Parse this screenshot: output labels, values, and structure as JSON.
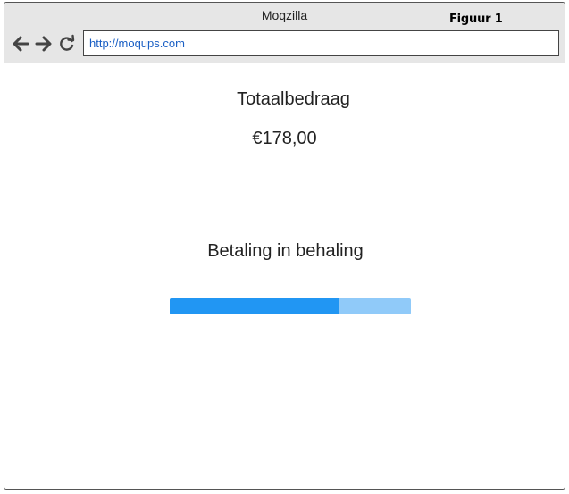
{
  "browser": {
    "window_title": "Moqzilla",
    "figure_label": "Figuur 1",
    "address_url": "http://moqups.com",
    "icons": {
      "back": "arrow-left-icon",
      "forward": "arrow-right-icon",
      "reload": "reload-icon"
    }
  },
  "payment": {
    "total_label": "Totaalbedraag",
    "total_amount": "€178,00",
    "status_text": "Betaling in behaling",
    "progress_fraction": 0.7,
    "colors": {
      "progress_fill": "#2196f3",
      "progress_track": "#90caf9"
    }
  }
}
